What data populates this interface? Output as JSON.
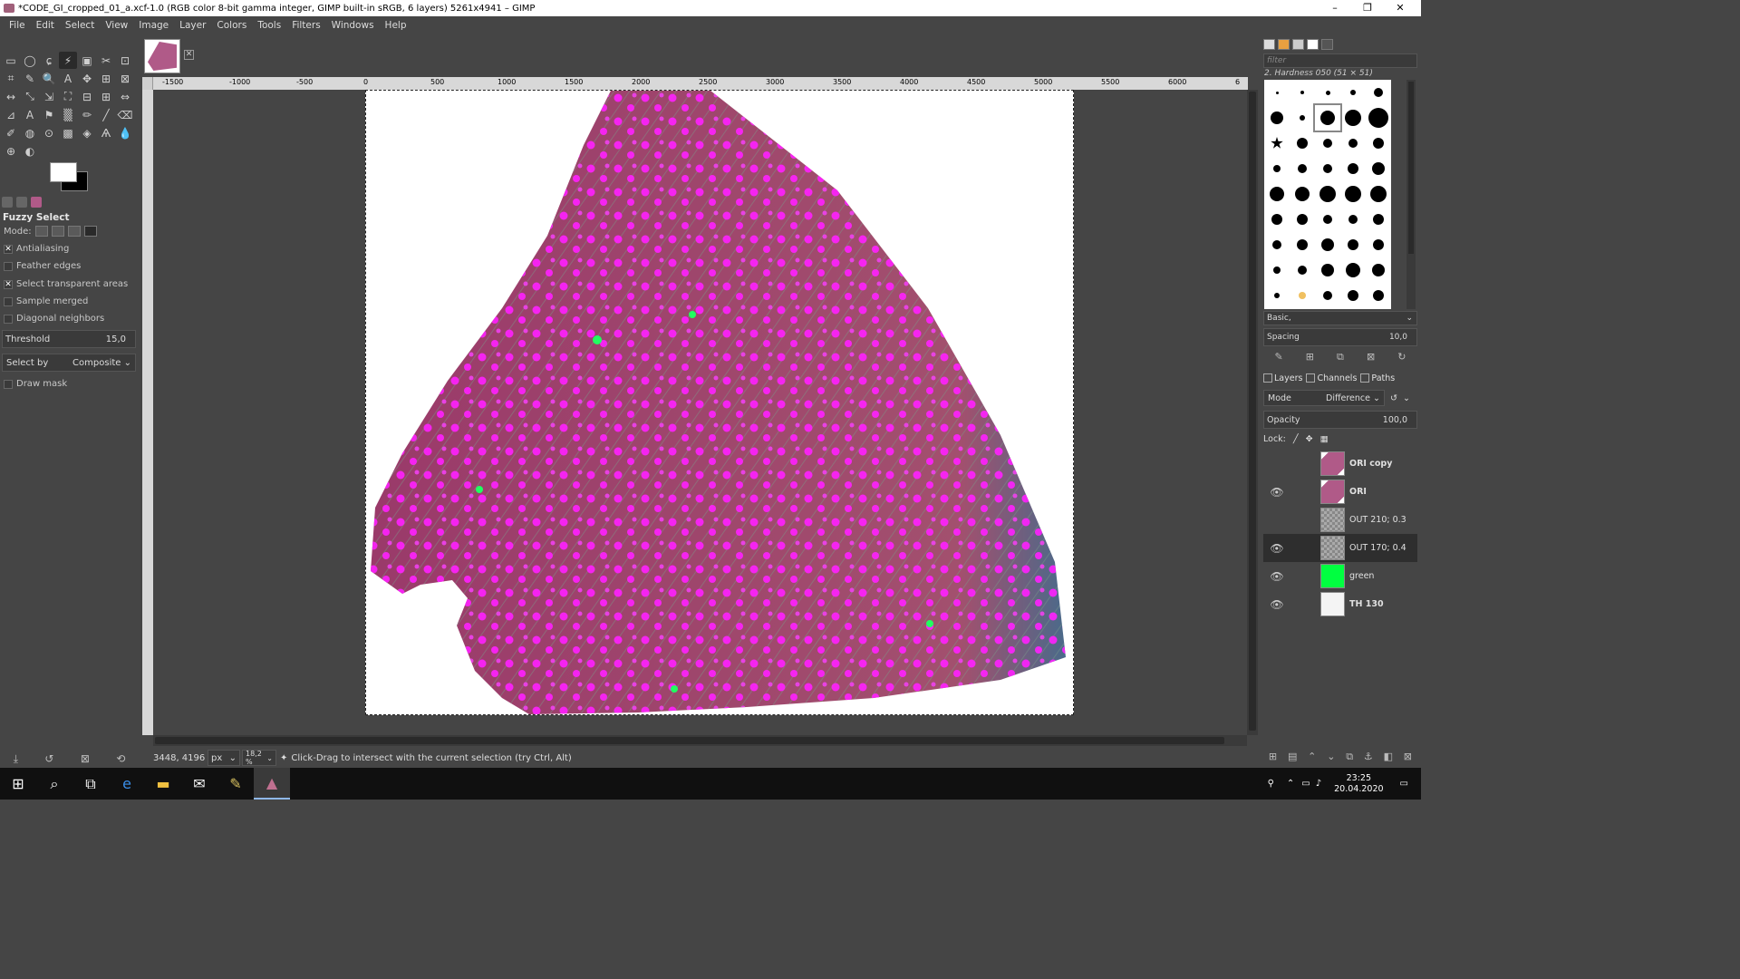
{
  "window": {
    "title": "*CODE_GI_cropped_01_a.xcf-1.0 (RGB color 8-bit gamma integer, GIMP built-in sRGB, 6 layers) 5261x4941 – GIMP",
    "minimize": "–",
    "maximize": "❐",
    "close": "✕"
  },
  "menu": [
    "File",
    "Edit",
    "Select",
    "View",
    "Image",
    "Layer",
    "Colors",
    "Tools",
    "Filters",
    "Windows",
    "Help"
  ],
  "toolbox": {
    "tools": [
      "▭",
      "◯",
      "ɕ",
      "⚡",
      "▣",
      "✂",
      "⊡",
      "⌗",
      "✎",
      "🔍",
      "A",
      "✥",
      "⊞",
      "⊠",
      "↔",
      "⤡",
      "⇲",
      "⛶",
      "⊟",
      "⊞",
      "⇔",
      "⊿",
      "A",
      "⚑",
      "▒",
      "✏",
      "╱",
      "⌫",
      "✐",
      "◍",
      "⊙",
      "▩",
      "◈",
      "Ѧ",
      "💧",
      "⊕",
      "◐"
    ],
    "active_tool_index": 3,
    "options_title": "Fuzzy Select",
    "mode_label": "Mode:",
    "antialiasing": {
      "label": "Antialiasing",
      "checked": true
    },
    "feather_edges": {
      "label": "Feather edges",
      "checked": false
    },
    "select_transparent": {
      "label": "Select transparent areas",
      "checked": true
    },
    "sample_merged": {
      "label": "Sample merged",
      "checked": false
    },
    "diagonal_neighbors": {
      "label": "Diagonal neighbors",
      "checked": false
    },
    "threshold": {
      "label": "Threshold",
      "value": "15,0"
    },
    "select_by": {
      "label": "Select by",
      "value": "Composite"
    },
    "draw_mask": {
      "label": "Draw mask",
      "checked": false
    }
  },
  "ruler": {
    "ticks": [
      "-1500",
      "-1000",
      "-500",
      "0",
      "500",
      "1000",
      "1500",
      "2000",
      "2500",
      "3000",
      "3500",
      "4000",
      "4500",
      "5000",
      "5500",
      "6000",
      "6"
    ]
  },
  "statusbar": {
    "coords": "3448, 4196",
    "unit": "px",
    "zoom": "18,2 %",
    "message": "Click-Drag to intersect with the current selection (try Ctrl, Alt)"
  },
  "brushes": {
    "filter_placeholder": "filter",
    "brush_name": "2. Hardness 050 (51 × 51)",
    "set": "Basic,",
    "spacing_label": "Spacing",
    "spacing_value": "10,0"
  },
  "layers_panel": {
    "tabs": [
      "Layers",
      "Channels",
      "Paths"
    ],
    "mode_label": "Mode",
    "mode_value": "Difference",
    "opacity_label": "Opacity",
    "opacity_value": "100,0",
    "lock_label": "Lock:",
    "layers": [
      {
        "name": "ORI copy",
        "visible": false,
        "bold": true,
        "thumb": "image",
        "selected": false
      },
      {
        "name": "ORI",
        "visible": true,
        "bold": true,
        "thumb": "image",
        "selected": false
      },
      {
        "name": "OUT 210; 0.3",
        "visible": false,
        "bold": false,
        "thumb": "gray",
        "selected": false
      },
      {
        "name": "OUT 170; 0.4",
        "visible": true,
        "bold": false,
        "thumb": "gray",
        "selected": true
      },
      {
        "name": "green",
        "visible": true,
        "bold": false,
        "thumb": "green",
        "selected": false
      },
      {
        "name": "TH 130",
        "visible": true,
        "bold": true,
        "thumb": "white",
        "selected": false
      }
    ]
  },
  "taskbar": {
    "time": "23:25",
    "date": "20.04.2020"
  },
  "colors": {
    "fg": "#ffffff",
    "bg": "#000000",
    "tissue": "#a0406e",
    "cells": "#ff1aff",
    "green_layer": "#00ff40"
  }
}
